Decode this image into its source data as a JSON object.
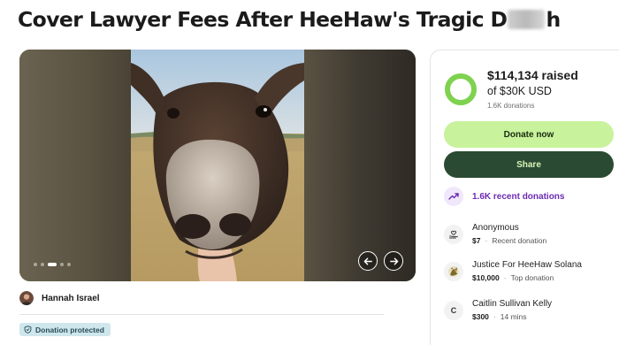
{
  "campaign": {
    "title_part1": "Cover Lawyer Fees After HeeHaw's Tragic D",
    "title_part2": "h"
  },
  "gallery": {
    "slide_count": 5,
    "active_slide": 3,
    "prev_icon": "arrow-left-icon",
    "next_icon": "arrow-right-icon"
  },
  "organizer": {
    "name": "Hannah Israel"
  },
  "badge": {
    "label": "Donation protected",
    "icon": "shield-icon"
  },
  "sidebar": {
    "raised": "$114,134 raised",
    "goal": "of $30K USD",
    "donations_count": "1.6K donations",
    "progress_fraction": 1.0,
    "donate_label": "Donate now",
    "share_label": "Share",
    "recent_label": "1.6K recent donations",
    "donors": [
      {
        "name": "Anonymous",
        "amount": "$7",
        "note": "Recent donation",
        "icon": "heart-hand-icon"
      },
      {
        "name": "Justice For HeeHaw Solana",
        "amount": "$10,000",
        "note": "Top donation",
        "icon": "avatar"
      },
      {
        "name": "Caitlin Sullivan Kelly",
        "amount": "$300",
        "note": "14 mins",
        "initial": "C"
      }
    ]
  },
  "colors": {
    "accent_green": "#c8f29b",
    "dark_green": "#2b4a33",
    "purple": "#6c2bb3",
    "protected_bg": "#cfe7ec"
  }
}
